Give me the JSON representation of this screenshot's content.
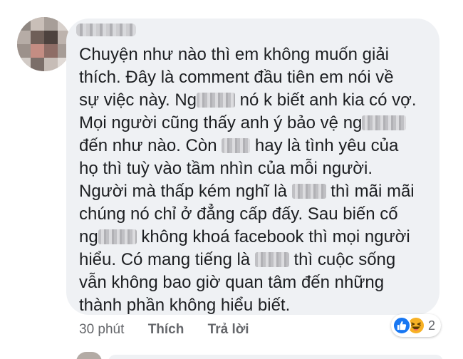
{
  "comment": {
    "lines": [
      [
        "Chuyện như nào thì em không muốn giải"
      ],
      [
        "thích. Đây là comment đầu tiên em nói về"
      ],
      [
        "sự việc này. Ng",
        " nó k biết anh kia có vợ."
      ],
      [
        "Mọi người cũng thấy anh ý bảo vệ ng",
        ""
      ],
      [
        "đến như nào. Còn ",
        " hay là tình yêu của"
      ],
      [
        "họ thì tuỳ vào tầm nhìn của mỗi người."
      ],
      [
        "Người mà thấp kém nghĩ là ",
        " thì mãi mãi"
      ],
      [
        "chúng nó chỉ ở đẳng cấp đấy. Sau biến cố"
      ],
      [
        "ng",
        " không khoá facebook thì mọi người"
      ],
      [
        "hiểu. Có mang tiếng là ",
        " thì cuộc sống"
      ],
      [
        "vẫn không bao giờ quan tâm đến những"
      ],
      [
        "thành phần không hiểu biết."
      ]
    ]
  },
  "actions": {
    "time": "30 phút",
    "like_label": "Thích",
    "reply_label": "Trả lời"
  },
  "reactions": {
    "icons": [
      "like-icon",
      "haha-icon"
    ],
    "count": "2",
    "like_color": "#1877f2",
    "haha_color": "#f7b125"
  },
  "colors": {
    "bubble": "#eff1f4",
    "text": "#1c1e21",
    "meta": "#65676b"
  }
}
